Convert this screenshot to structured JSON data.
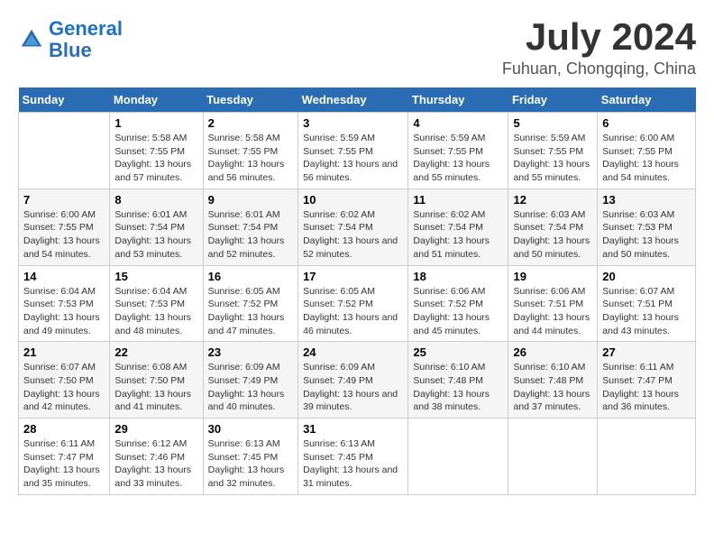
{
  "header": {
    "logo_line1": "General",
    "logo_line2": "Blue",
    "month_year": "July 2024",
    "location": "Fuhuan, Chongqing, China"
  },
  "days_of_week": [
    "Sunday",
    "Monday",
    "Tuesday",
    "Wednesday",
    "Thursday",
    "Friday",
    "Saturday"
  ],
  "weeks": [
    [
      {
        "day": "",
        "info": ""
      },
      {
        "day": "1",
        "info": "Sunrise: 5:58 AM\nSunset: 7:55 PM\nDaylight: 13 hours\nand 57 minutes."
      },
      {
        "day": "2",
        "info": "Sunrise: 5:58 AM\nSunset: 7:55 PM\nDaylight: 13 hours\nand 56 minutes."
      },
      {
        "day": "3",
        "info": "Sunrise: 5:59 AM\nSunset: 7:55 PM\nDaylight: 13 hours\nand 56 minutes."
      },
      {
        "day": "4",
        "info": "Sunrise: 5:59 AM\nSunset: 7:55 PM\nDaylight: 13 hours\nand 55 minutes."
      },
      {
        "day": "5",
        "info": "Sunrise: 5:59 AM\nSunset: 7:55 PM\nDaylight: 13 hours\nand 55 minutes."
      },
      {
        "day": "6",
        "info": "Sunrise: 6:00 AM\nSunset: 7:55 PM\nDaylight: 13 hours\nand 54 minutes."
      }
    ],
    [
      {
        "day": "7",
        "info": "Sunrise: 6:00 AM\nSunset: 7:55 PM\nDaylight: 13 hours\nand 54 minutes."
      },
      {
        "day": "8",
        "info": "Sunrise: 6:01 AM\nSunset: 7:54 PM\nDaylight: 13 hours\nand 53 minutes."
      },
      {
        "day": "9",
        "info": "Sunrise: 6:01 AM\nSunset: 7:54 PM\nDaylight: 13 hours\nand 52 minutes."
      },
      {
        "day": "10",
        "info": "Sunrise: 6:02 AM\nSunset: 7:54 PM\nDaylight: 13 hours\nand 52 minutes."
      },
      {
        "day": "11",
        "info": "Sunrise: 6:02 AM\nSunset: 7:54 PM\nDaylight: 13 hours\nand 51 minutes."
      },
      {
        "day": "12",
        "info": "Sunrise: 6:03 AM\nSunset: 7:54 PM\nDaylight: 13 hours\nand 50 minutes."
      },
      {
        "day": "13",
        "info": "Sunrise: 6:03 AM\nSunset: 7:53 PM\nDaylight: 13 hours\nand 50 minutes."
      }
    ],
    [
      {
        "day": "14",
        "info": "Sunrise: 6:04 AM\nSunset: 7:53 PM\nDaylight: 13 hours\nand 49 minutes."
      },
      {
        "day": "15",
        "info": "Sunrise: 6:04 AM\nSunset: 7:53 PM\nDaylight: 13 hours\nand 48 minutes."
      },
      {
        "day": "16",
        "info": "Sunrise: 6:05 AM\nSunset: 7:52 PM\nDaylight: 13 hours\nand 47 minutes."
      },
      {
        "day": "17",
        "info": "Sunrise: 6:05 AM\nSunset: 7:52 PM\nDaylight: 13 hours\nand 46 minutes."
      },
      {
        "day": "18",
        "info": "Sunrise: 6:06 AM\nSunset: 7:52 PM\nDaylight: 13 hours\nand 45 minutes."
      },
      {
        "day": "19",
        "info": "Sunrise: 6:06 AM\nSunset: 7:51 PM\nDaylight: 13 hours\nand 44 minutes."
      },
      {
        "day": "20",
        "info": "Sunrise: 6:07 AM\nSunset: 7:51 PM\nDaylight: 13 hours\nand 43 minutes."
      }
    ],
    [
      {
        "day": "21",
        "info": "Sunrise: 6:07 AM\nSunset: 7:50 PM\nDaylight: 13 hours\nand 42 minutes."
      },
      {
        "day": "22",
        "info": "Sunrise: 6:08 AM\nSunset: 7:50 PM\nDaylight: 13 hours\nand 41 minutes."
      },
      {
        "day": "23",
        "info": "Sunrise: 6:09 AM\nSunset: 7:49 PM\nDaylight: 13 hours\nand 40 minutes."
      },
      {
        "day": "24",
        "info": "Sunrise: 6:09 AM\nSunset: 7:49 PM\nDaylight: 13 hours\nand 39 minutes."
      },
      {
        "day": "25",
        "info": "Sunrise: 6:10 AM\nSunset: 7:48 PM\nDaylight: 13 hours\nand 38 minutes."
      },
      {
        "day": "26",
        "info": "Sunrise: 6:10 AM\nSunset: 7:48 PM\nDaylight: 13 hours\nand 37 minutes."
      },
      {
        "day": "27",
        "info": "Sunrise: 6:11 AM\nSunset: 7:47 PM\nDaylight: 13 hours\nand 36 minutes."
      }
    ],
    [
      {
        "day": "28",
        "info": "Sunrise: 6:11 AM\nSunset: 7:47 PM\nDaylight: 13 hours\nand 35 minutes."
      },
      {
        "day": "29",
        "info": "Sunrise: 6:12 AM\nSunset: 7:46 PM\nDaylight: 13 hours\nand 33 minutes."
      },
      {
        "day": "30",
        "info": "Sunrise: 6:13 AM\nSunset: 7:45 PM\nDaylight: 13 hours\nand 32 minutes."
      },
      {
        "day": "31",
        "info": "Sunrise: 6:13 AM\nSunset: 7:45 PM\nDaylight: 13 hours\nand 31 minutes."
      },
      {
        "day": "",
        "info": ""
      },
      {
        "day": "",
        "info": ""
      },
      {
        "day": "",
        "info": ""
      }
    ]
  ]
}
